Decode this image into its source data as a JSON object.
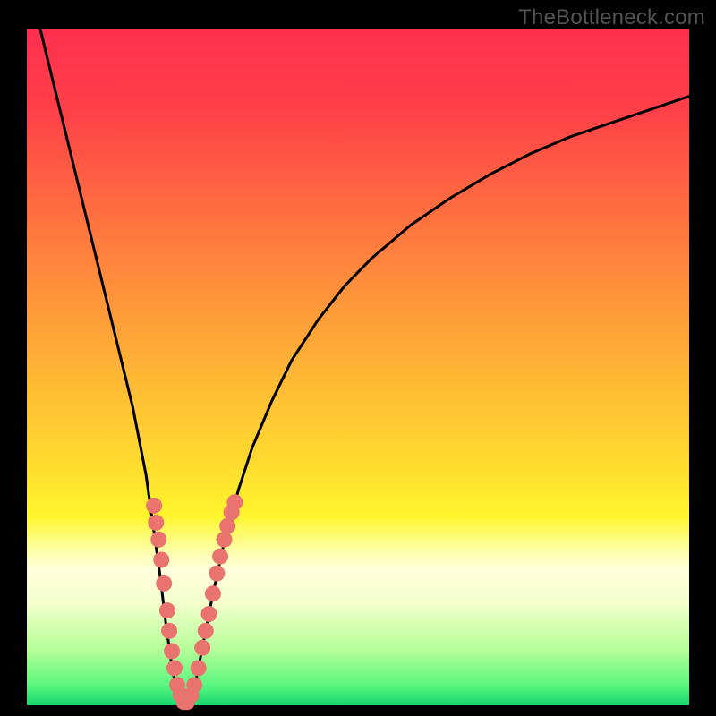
{
  "watermark": {
    "text": "TheBottleneck.com"
  },
  "colors": {
    "frame": "#000000",
    "curve": "#000000",
    "marker_fill": "#E9736E",
    "gradient_stops": [
      {
        "pct": 0,
        "color": "#FF2F4E"
      },
      {
        "pct": 12,
        "color": "#FF4048"
      },
      {
        "pct": 25,
        "color": "#FF6841"
      },
      {
        "pct": 38,
        "color": "#FF8F3B"
      },
      {
        "pct": 52,
        "color": "#FFB934"
      },
      {
        "pct": 66,
        "color": "#FFE02E"
      },
      {
        "pct": 72,
        "color": "#FFF52B"
      },
      {
        "pct": 77,
        "color": "#FEFFA5"
      },
      {
        "pct": 80,
        "color": "#FFFFDC"
      },
      {
        "pct": 85,
        "color": "#F3FFCB"
      },
      {
        "pct": 92,
        "color": "#B3FF98"
      },
      {
        "pct": 97,
        "color": "#5AF67F"
      },
      {
        "pct": 100,
        "color": "#18D86D"
      }
    ]
  },
  "chart_data": {
    "type": "line",
    "title": "",
    "xlabel": "",
    "ylabel": "",
    "xlim": [
      0,
      100
    ],
    "ylim": [
      0,
      100
    ],
    "grid": false,
    "legend": false,
    "series": [
      {
        "name": "curve",
        "x": [
          2,
          4,
          6,
          8,
          10,
          12,
          14,
          16,
          18,
          19,
          20,
          21,
          22,
          23,
          24,
          25,
          26,
          28,
          30,
          32,
          34,
          37,
          40,
          44,
          48,
          52,
          58,
          64,
          70,
          76,
          82,
          88,
          94,
          100
        ],
        "y": [
          100,
          92,
          84,
          76,
          68,
          60,
          52,
          44,
          34,
          27,
          20,
          12,
          5,
          1,
          0,
          1,
          6,
          16,
          25,
          32,
          38,
          45,
          51,
          57,
          62,
          66,
          71,
          75,
          78.5,
          81.5,
          84,
          86,
          88,
          90
        ]
      }
    ],
    "markers": {
      "name": "highlighted-points",
      "points": [
        {
          "x": 19.2,
          "y": 29.5
        },
        {
          "x": 19.5,
          "y": 27.0
        },
        {
          "x": 19.9,
          "y": 24.5
        },
        {
          "x": 20.3,
          "y": 21.5
        },
        {
          "x": 20.7,
          "y": 18.0
        },
        {
          "x": 21.2,
          "y": 14.0
        },
        {
          "x": 21.5,
          "y": 11.0
        },
        {
          "x": 21.9,
          "y": 8.0
        },
        {
          "x": 22.3,
          "y": 5.5
        },
        {
          "x": 22.7,
          "y": 3.0
        },
        {
          "x": 23.2,
          "y": 1.5
        },
        {
          "x": 23.7,
          "y": 0.5
        },
        {
          "x": 24.2,
          "y": 0.5
        },
        {
          "x": 24.8,
          "y": 1.5
        },
        {
          "x": 25.3,
          "y": 3.0
        },
        {
          "x": 25.9,
          "y": 5.5
        },
        {
          "x": 26.5,
          "y": 8.5
        },
        {
          "x": 27.0,
          "y": 11.0
        },
        {
          "x": 27.5,
          "y": 13.5
        },
        {
          "x": 28.1,
          "y": 16.5
        },
        {
          "x": 28.7,
          "y": 19.5
        },
        {
          "x": 29.2,
          "y": 22.0
        },
        {
          "x": 29.8,
          "y": 24.5
        },
        {
          "x": 30.3,
          "y": 26.5
        },
        {
          "x": 30.9,
          "y": 28.5
        },
        {
          "x": 31.4,
          "y": 30.0
        }
      ]
    }
  }
}
